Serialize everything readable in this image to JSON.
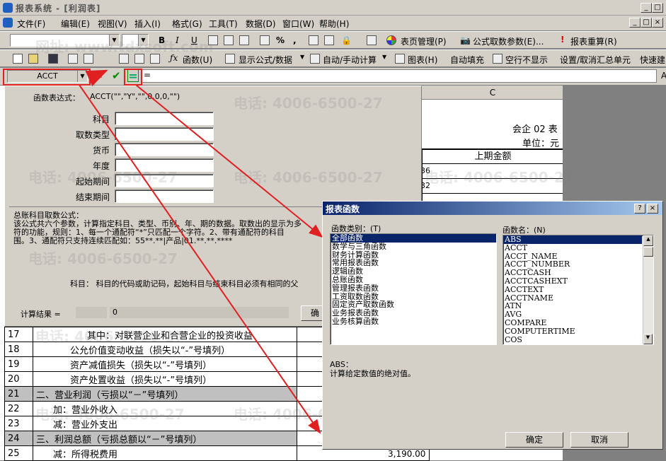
{
  "window": {
    "title": "报表系统 - [利润表]",
    "min_label": "_",
    "max_label": "□",
    "close_label": "×",
    "min2_label": "_",
    "max2_label": "□",
    "close2_label": "×"
  },
  "menu": {
    "items": [
      "文件(F)",
      "编辑(E)",
      "视图(V)",
      "插入(I)",
      "格式(G)",
      "工具(T)",
      "数据(D)",
      "窗口(W)",
      "帮助(H)"
    ]
  },
  "toolbar1": {
    "bold": "B",
    "italic": "I",
    "underline": "U",
    "percent": "%",
    "comma": ",",
    "page_manage": "表页管理(P)",
    "formula_params": "公式取数参数(E)...",
    "recalc": "报表重算(R)"
  },
  "toolbar2": {
    "function": "函数(U)",
    "show_formula": "显示公式/数据",
    "auto_manual": "自动/手动计算",
    "chart": "图表(H)",
    "autofill": "自动填充",
    "hide_empty": "空行不显示",
    "summary_cell": "设置/取消汇总单元",
    "quick_build": "快速建"
  },
  "formula_bar": {
    "cell_combo": "ACCT",
    "input_text": "=",
    "right_label": "A"
  },
  "acct_panel": {
    "expression_label": "函数表达式：",
    "expression": "ACCT(\"\",\"Y\",\"\",0,0,0,\"\")",
    "fields": [
      {
        "label": "科目",
        "value": ""
      },
      {
        "label": "取数类型",
        "value": ""
      },
      {
        "label": "货币",
        "value": ""
      },
      {
        "label": "年度",
        "value": ""
      },
      {
        "label": "起始期间",
        "value": ""
      },
      {
        "label": "结束期间",
        "value": ""
      }
    ],
    "desc_title": "总账科目取数公式：",
    "desc_lines": [
      "该公式共六个参数，计算指定科目、类型、币别、年、期的数据。取数出的显示为多",
      "符的功能，规则：1、每一个通配符“*”只匹配一个字符。2、带有通配符的科目",
      "围。3、通配符只支持连续匹配如：55**.**|产品|01.**.**.****"
    ],
    "help_text": "科目：  科目的代码或助记码，起始科目与结束科目必须有相同的父",
    "result_label": "计算结果 =",
    "result_value": "0",
    "ok_button": "确"
  },
  "sheet_top": {
    "col_c": "C",
    "company": "会企 02 表",
    "unit": "单位：元",
    "prev_amount": "上期金额",
    "partial_values": [
      "36",
      "32"
    ]
  },
  "rows": [
    {
      "num": "17",
      "text": "其中：对联营企业和合营企业的投资收益",
      "indent": 3,
      "shaded": false
    },
    {
      "num": "18",
      "text": "公允价值变动收益（损失以“-”号填列）",
      "indent": 2,
      "shaded": false
    },
    {
      "num": "19",
      "text": "资产减值损失（损失以“-”号填列）",
      "indent": 2,
      "shaded": false
    },
    {
      "num": "20",
      "text": "资产处置收益（损失以“-”号填列）",
      "indent": 2,
      "shaded": false
    },
    {
      "num": "21",
      "text": "二、营业利润（亏损以“－”号填列）",
      "indent": 0,
      "shaded": true
    },
    {
      "num": "22",
      "text": "加：营业外收入",
      "indent": 1,
      "shaded": false
    },
    {
      "num": "23",
      "text": "减：营业外支出",
      "indent": 1,
      "shaded": false
    },
    {
      "num": "24",
      "text": "三、利润总额（亏损总额以“－”号填列）",
      "indent": 0,
      "shaded": true
    },
    {
      "num": "25",
      "text": "减：所得税费用",
      "indent": 1,
      "shaded": false
    }
  ],
  "row25_value": "3,190.00",
  "dialog": {
    "title": "报表函数",
    "help_btn": "?",
    "close_btn": "×",
    "category_label": "函数类别：(T)",
    "name_label": "函数名：(N)",
    "categories": [
      "全部函数",
      "数学与三角函数",
      "财务计算函数",
      "常用报表函数",
      "逻辑函数",
      "总账函数",
      "管理报表函数",
      "工资取数函数",
      "固定资产取数函数",
      "业务报表函数",
      "业务核算函数"
    ],
    "names": [
      "ABS",
      "ACCT",
      "ACCT_NAME",
      "ACCT_NUMBER",
      "ACCTCASH",
      "ACCTCASHEXT",
      "ACCTEXT",
      "ACCTNAME",
      "ATN",
      "AVG",
      "COMPARE",
      "COMPUTERTIME",
      "COS"
    ],
    "desc_title": "ABS：",
    "desc_text": "计算给定数值的绝对值。",
    "ok": "确定",
    "cancel": "取消"
  },
  "watermarks": {
    "phone": "电话: 4006-6500-27",
    "site": "网址: www.tdxsoft.com"
  },
  "colors": {
    "annotation_red": "#e02020",
    "title_blue": "#0a246a"
  }
}
